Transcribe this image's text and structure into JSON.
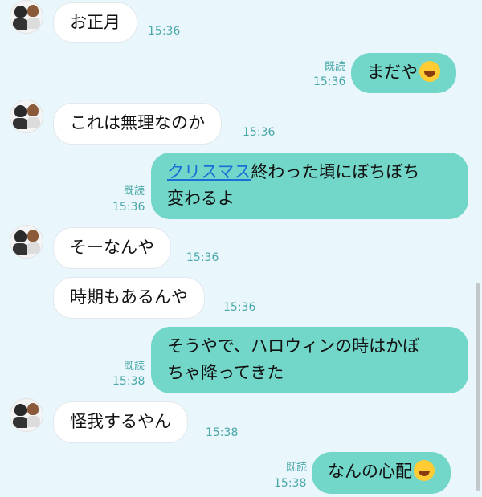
{
  "messages": [
    {
      "side": "in",
      "text": "お正月",
      "time": "15:36"
    },
    {
      "side": "out",
      "text": "まだや",
      "read": "既読",
      "time": "15:36",
      "emoji": "laughing-with-tears-emoji"
    },
    {
      "side": "in",
      "text": "これは無理なのか",
      "time": "15:36"
    },
    {
      "side": "out",
      "link": "クリスマス",
      "text_line1": "終わった頃にぼちぼち",
      "text_line2": "変わるよ",
      "read": "既読",
      "time": "15:36"
    },
    {
      "side": "in",
      "text": "そーなんや",
      "time": "15:36"
    },
    {
      "side": "in",
      "text": "時期もあるんや",
      "time": "15:36"
    },
    {
      "side": "out",
      "text_line1": "そうやで、ハロウィンの時はかぼ",
      "text_line2": "ちゃ降ってきた",
      "read": "既読",
      "time": "15:38"
    },
    {
      "side": "in",
      "text": "怪我するやん",
      "time": "15:38"
    },
    {
      "side": "out",
      "text": "なんの心配",
      "read": "既読",
      "time": "15:38",
      "emoji": "laughing-with-tears-emoji"
    }
  ],
  "colors": {
    "background": "#e9f6fb",
    "outgoing_bubble": "#72d6c9",
    "incoming_bubble": "#ffffff",
    "timestamp": "#4aa8a8",
    "link": "#1a6fd6"
  }
}
